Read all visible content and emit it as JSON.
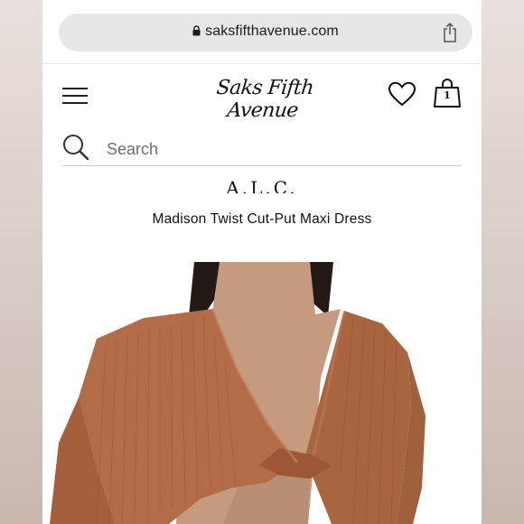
{
  "browser": {
    "url": "saksfifthavenue.com"
  },
  "header": {
    "logo": "Saks Fifth Avenue",
    "cart_count": "1"
  },
  "search": {
    "placeholder": "Search"
  },
  "product": {
    "brand": "A.L.C.",
    "title": "Madison Twist Cut-Put Maxi Dress"
  },
  "colors": {
    "garment": "#b06a43",
    "url_bar": "#e6e7e9"
  }
}
